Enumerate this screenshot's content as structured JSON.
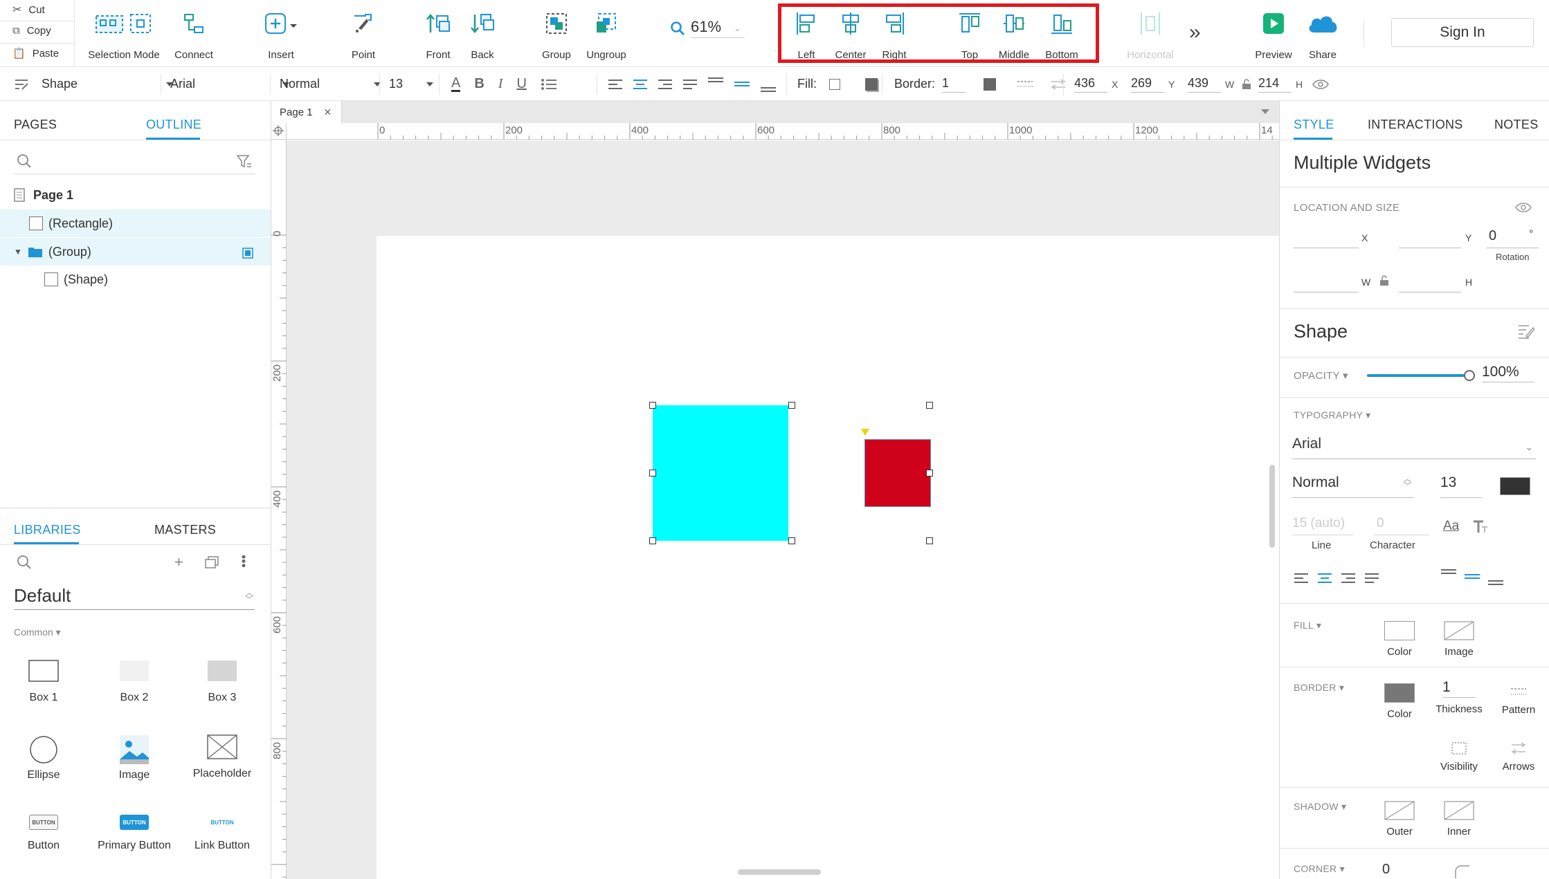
{
  "clipboard": {
    "cut": "Cut",
    "copy": "Copy",
    "paste": "Paste"
  },
  "toolbar": {
    "selection_mode": "Selection Mode",
    "connect": "Connect",
    "insert": "Insert",
    "point": "Point",
    "front": "Front",
    "back": "Back",
    "group": "Group",
    "ungroup": "Ungroup",
    "zoom": "61%",
    "align_left": "Left",
    "align_center": "Center",
    "align_right": "Right",
    "align_top": "Top",
    "align_middle": "Middle",
    "align_bottom": "Bottom",
    "horizontal": "Horizontal",
    "preview": "Preview",
    "share": "Share",
    "sign_in": "Sign In"
  },
  "format_bar": {
    "style": "Shape",
    "font": "Arial",
    "weight": "Normal",
    "size": "13",
    "fill_label": "Fill:",
    "border_label": "Border:",
    "border_value": "1",
    "x_value": "436",
    "x_label": "X",
    "y_value": "269",
    "y_label": "Y",
    "w_value": "439",
    "w_label": "W",
    "h_value": "214",
    "h_label": "H"
  },
  "left_panel": {
    "tabs": {
      "pages": "PAGES",
      "outline": "OUTLINE"
    },
    "tree": {
      "page": "Page 1",
      "rectangle": "(Rectangle)",
      "group": "(Group)",
      "shape": "(Shape)"
    },
    "lib_tabs": {
      "libraries": "LIBRARIES",
      "masters": "MASTERS"
    },
    "library_name": "Default",
    "category": "Common ▾",
    "items": [
      "Box 1",
      "Box 2",
      "Box 3",
      "Ellipse",
      "Image",
      "Placeholder",
      "Button",
      "Primary Button",
      "Link Button"
    ],
    "button_word": "BUTTON"
  },
  "canvas": {
    "page_tab": "Page 1",
    "h_ticks": [
      "0",
      "200",
      "400",
      "600",
      "800",
      "1000",
      "1200",
      "14"
    ],
    "v_ticks": [
      "0",
      "200",
      "400",
      "600",
      "800"
    ],
    "colors": {
      "cyan": "#00ffff",
      "red": "#d0021b"
    }
  },
  "right_panel": {
    "tabs": {
      "style": "STYLE",
      "interactions": "INTERACTIONS",
      "notes": "NOTES"
    },
    "title": "Multiple Widgets",
    "location_size": "LOCATION AND SIZE",
    "x_label": "X",
    "y_label": "Y",
    "w_label": "W",
    "h_label": "H",
    "rotation_value": "0",
    "rotation_unit": "°",
    "rotation_label": "Rotation",
    "shape_title": "Shape",
    "opacity_label": "OPACITY ▾",
    "opacity_value": "100%",
    "opacity_level": 1.0,
    "typography_label": "TYPOGRAPHY ▾",
    "font": "Arial",
    "weight": "Normal",
    "size": "13",
    "line_value": "15 (auto)",
    "line_label": "Line",
    "char_value": "0",
    "char_label": "Character",
    "aa": "Aa",
    "fill_label": "FILL ▾",
    "fill_color": "Color",
    "fill_image": "Image",
    "border_label": "BORDER ▾",
    "border_color": "Color",
    "thickness_value": "1",
    "thickness_label": "Thickness",
    "pattern_label": "Pattern",
    "visibility_label": "Visibility",
    "arrows_label": "Arrows",
    "shadow_label": "SHADOW ▾",
    "outer_label": "Outer",
    "inner_label": "Inner",
    "corner_label": "CORNER ▾",
    "corner_value": "0"
  }
}
